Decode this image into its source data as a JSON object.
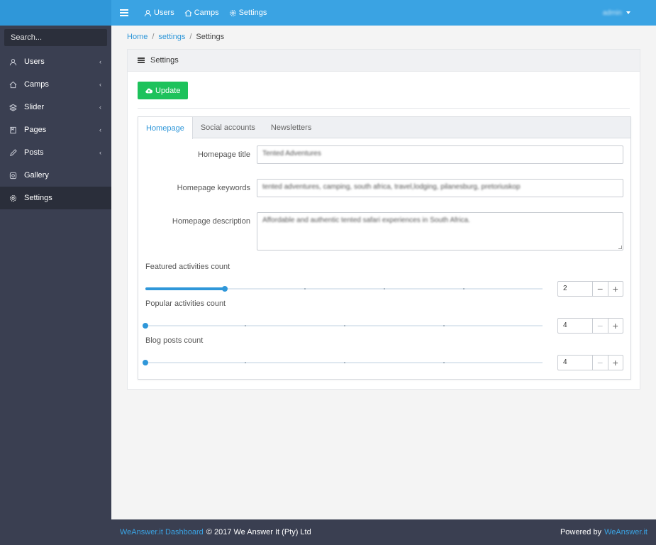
{
  "topbar": {
    "nav": [
      {
        "label": "Users",
        "icon": "user-icon"
      },
      {
        "label": "Camps",
        "icon": "home-icon"
      },
      {
        "label": "Settings",
        "icon": "gear-icon"
      }
    ],
    "user_name": "admin"
  },
  "sidebar": {
    "search_placeholder": "Search...",
    "items": [
      {
        "label": "Users",
        "icon": "user-icon",
        "has_submenu": true
      },
      {
        "label": "Camps",
        "icon": "home-icon",
        "has_submenu": true
      },
      {
        "label": "Slider",
        "icon": "layers-icon",
        "has_submenu": true
      },
      {
        "label": "Pages",
        "icon": "pages-icon",
        "has_submenu": true
      },
      {
        "label": "Posts",
        "icon": "pencil-icon",
        "has_submenu": true
      },
      {
        "label": "Gallery",
        "icon": "instagram-icon",
        "has_submenu": false
      },
      {
        "label": "Settings",
        "icon": "gear-icon",
        "has_submenu": false,
        "active": true
      }
    ]
  },
  "breadcrumb": {
    "home": "Home",
    "section": "settings",
    "current": "Settings",
    "separator": "/"
  },
  "card": {
    "title": "Settings",
    "update_label": "Update",
    "tabs": [
      "Homepage",
      "Social accounts",
      "Newsletters"
    ],
    "active_tab": 0
  },
  "form": {
    "homepage_title_label": "Homepage title",
    "homepage_title_value": "Tented Adventures",
    "homepage_keywords_label": "Homepage keywords",
    "homepage_keywords_value": "tented adventures, camping, south africa, travel,lodging, pilanesburg, pretoriuskop",
    "homepage_description_label": "Homepage description",
    "homepage_description_value": "Affordable and authentic tented safari experiences in South Africa.",
    "featured_label": "Featured activities count",
    "featured_value": "2",
    "featured_fraction": 0.2,
    "popular_label": "Popular activities count",
    "popular_value": "4",
    "popular_fraction": 0,
    "blog_label": "Blog posts count",
    "blog_value": "4",
    "blog_fraction": 0
  },
  "footer": {
    "brand_link": "WeAnswer.it Dashboard",
    "copyright": "© 2017 We Answer It (Pty) Ltd",
    "powered_by": "Powered by",
    "powered_link": "WeAnswer.it"
  },
  "colors": {
    "accent": "#3aa3e3",
    "sidebar": "#3a3f51",
    "update_button": "#1dc25b"
  }
}
